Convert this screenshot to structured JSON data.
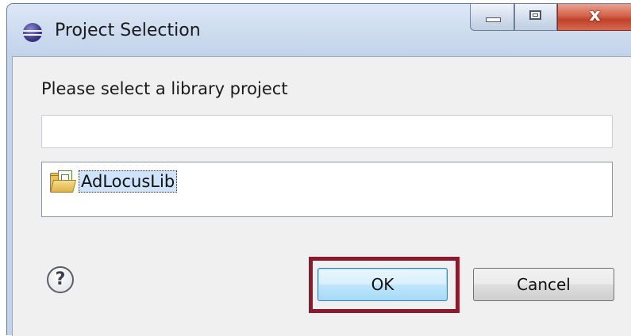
{
  "window": {
    "title": "Project Selection",
    "close_glyph": "x",
    "icons": {
      "app": "eclipse-icon",
      "minimize": "minimize-icon",
      "maximize": "maximize-icon",
      "close": "close-icon"
    }
  },
  "dialog": {
    "prompt": "Please select a library project",
    "filter": {
      "value": "",
      "placeholder": ""
    },
    "projects": [
      {
        "label": "AdLocusLib",
        "icon": "project-folder-icon",
        "selected": true
      }
    ],
    "help_glyph": "?",
    "buttons": {
      "ok": "OK",
      "cancel": "Cancel"
    }
  },
  "colors": {
    "highlight_annotation": "#8b1a2e",
    "ok_button_border": "#3c7fb1",
    "close_button": "#c2412a"
  }
}
